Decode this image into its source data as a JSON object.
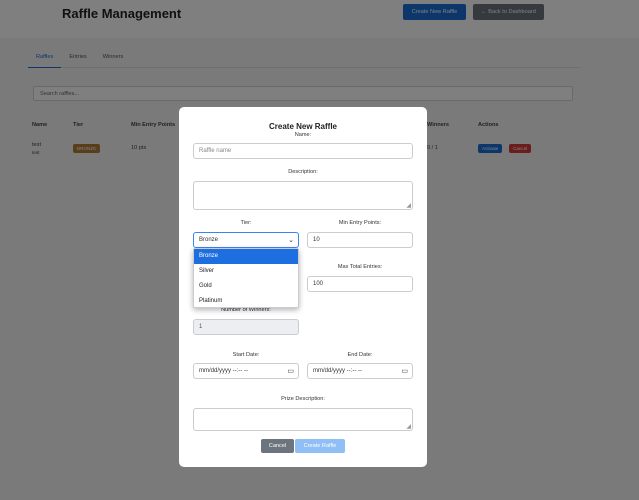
{
  "header": {
    "title": "Raffle Management",
    "create_button": "Create New Raffle",
    "back_button": "← Back to Dashboard"
  },
  "tabs": [
    "Raffles",
    "Entries",
    "Winners"
  ],
  "search": {
    "placeholder": "Search raffles..."
  },
  "table": {
    "headers": [
      "Name",
      "Tier",
      "Min Entry Points",
      "Winners",
      "Actions"
    ],
    "rows": [
      {
        "name": "test",
        "sub": "test",
        "tier": "BRONZE",
        "min_points": "10 pts",
        "winners": "0 / 1",
        "activate": "Activate",
        "cancel": "Cancel"
      }
    ]
  },
  "modal": {
    "title": "Create New Raffle",
    "name_label": "Name:",
    "name_placeholder": "Raffle name",
    "description_label": "Description:",
    "tier_label": "Tier:",
    "tier_value": "Bronze",
    "tier_options": [
      "Bronze",
      "Silver",
      "Gold",
      "Platinum"
    ],
    "min_points_label": "Min Entry Points:",
    "min_points_value": "10",
    "max_entries_label": "Max Total Entries:",
    "max_entries_value": "100",
    "winners_label": "Number of Winners:",
    "winners_value": "1",
    "start_label": "Start Date:",
    "start_value": "mm/dd/yyyy --:-- --",
    "end_label": "End Date:",
    "end_value": "mm/dd/yyyy --:-- --",
    "prize_label": "Prize Description:",
    "cancel_button": "Cancel",
    "create_button": "Create Raffle"
  },
  "colors": {
    "primary": "#1b6fd6",
    "secondary": "#6c757d",
    "bronze": "#b57a34",
    "danger": "#d23a3a",
    "create_disabled": "#8fbff5"
  }
}
